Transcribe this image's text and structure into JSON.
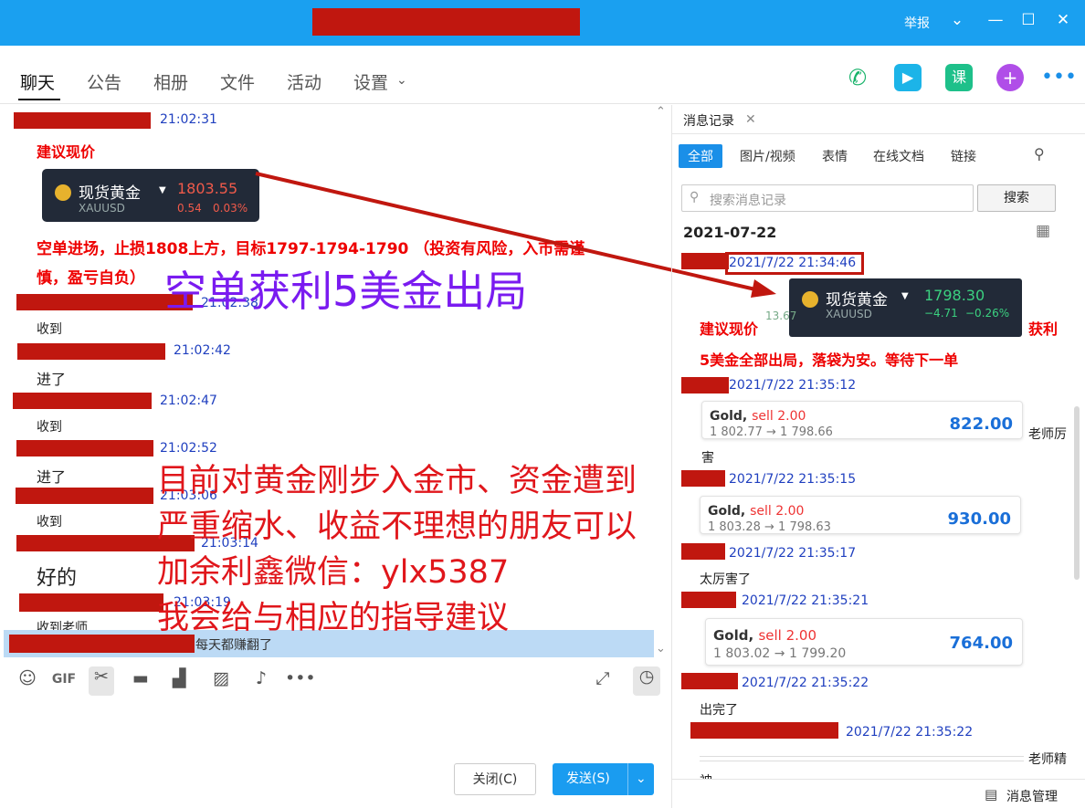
{
  "titlebar": {
    "report": "举报"
  },
  "tabs": [
    "聊天",
    "公告",
    "相册",
    "文件",
    "活动",
    "设置"
  ],
  "toolbar_actions": {
    "voice_icon": "phone-icon",
    "video_icon": "video-icon",
    "lesson_label": "课",
    "add_icon": "plus-icon",
    "more_icon": "more-icon"
  },
  "chat": {
    "messages": [
      {
        "time": "21:02:31"
      },
      {
        "time": "21:02:38",
        "text": "收到"
      },
      {
        "time": "21:02:42",
        "text": "进了"
      },
      {
        "time": "21:02:47",
        "text": "收到"
      },
      {
        "time": "21:02:52",
        "text": "进了"
      },
      {
        "time": "21:03:06",
        "text": "收到"
      },
      {
        "time": "21:03:14",
        "text": "好的"
      },
      {
        "time": "21:03:19",
        "text": "收到老师"
      }
    ],
    "suggest": "建议现价",
    "quote": {
      "name": "现货黄金",
      "price": "1803.55",
      "change": "0.54",
      "pct": "0.03%",
      "symbol": "XAUUSD"
    },
    "entry": "空单进场，止损1808上方，目标1797-1794-1790 （投资有风险，入市需谨",
    "entry2": "慎，盈亏自负）",
    "selected_text": "每天都赚翻了",
    "overlay_purple": "空单获利5美金出局",
    "overlay_red": [
      "目前对黄金刚步入金市、资金遭到",
      "严重缩水、收益不理想的朋友可以",
      "加余利鑫微信：ylx5387",
      "我会给与相应的指导建议"
    ]
  },
  "buttons": {
    "close": "关闭(C)",
    "send": "发送(S)"
  },
  "side": {
    "title": "消息记录",
    "filters": [
      "全部",
      "图片/视频",
      "表情",
      "在线文档",
      "链接"
    ],
    "search_placeholder": "搜索消息记录",
    "search_button": "搜索",
    "date": "2021-07-22",
    "entries": [
      {
        "time": "2021/7/22 21:34:46"
      },
      {
        "time": "2021/7/22 21:35:12"
      },
      {
        "time": "2021/7/22 21:35:15"
      },
      {
        "time": "2021/7/22 21:35:17"
      },
      {
        "time": "2021/7/22 21:35:21"
      },
      {
        "time": "2021/7/22 21:35:22"
      },
      {
        "time": "2021/7/22 21:35:22"
      }
    ],
    "quote": {
      "name": "现货黄金",
      "price": "1798.30",
      "change": "−4.71",
      "pct": "−0.26%",
      "symbol": "XAUUSD",
      "partial": "13.67"
    },
    "red_line1a": "建议现价",
    "red_line1b": "获利",
    "red_line2": "5美金全部出局，落袋为安。等待下一单",
    "trades": [
      {
        "name": "Gold,",
        "side": "sell 2.00",
        "path": "1 802.77 → 1 798.66",
        "amount": "822.00"
      },
      {
        "name": "Gold,",
        "side": "sell 2.00",
        "path": "1 803.28 → 1 798.63",
        "amount": "930.00"
      },
      {
        "name": "Gold,",
        "side": "sell 2.00",
        "path": "1 803.02 → 1 799.20",
        "amount": "764.00"
      }
    ],
    "notes": [
      "老师厉",
      "害",
      "太厉害了",
      "出完了",
      "老师精",
      "神"
    ],
    "manage": "消息管理"
  },
  "colors": {
    "titlebar": "#1aa0f0",
    "redact": "#c0170f",
    "send": "#1a9cf0"
  }
}
